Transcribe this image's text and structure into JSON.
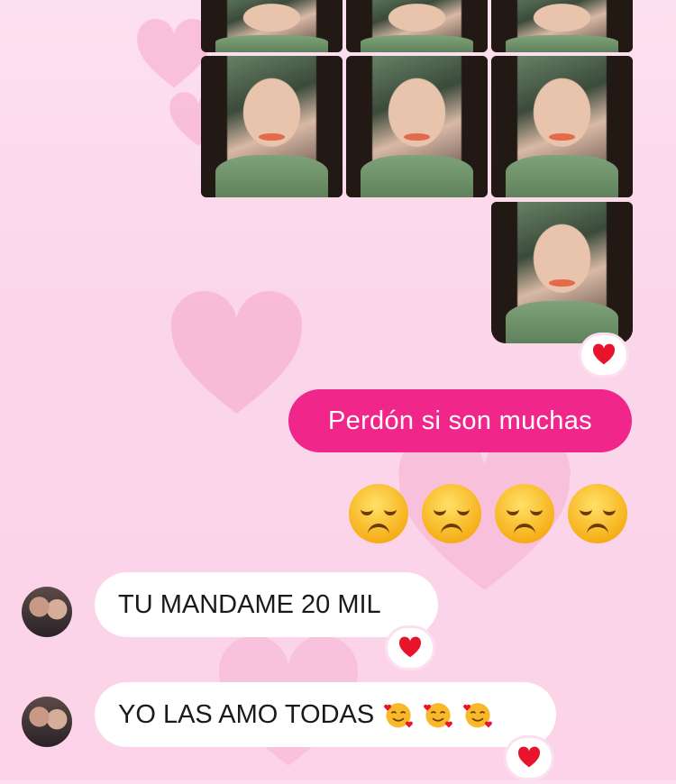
{
  "messages": [
    {
      "from": "me",
      "type": "text",
      "text": "Perdón si son muchas"
    },
    {
      "from": "me",
      "type": "emoji",
      "text": "😞😞😞😞"
    },
    {
      "from": "them",
      "type": "text",
      "text": "TU MANDAME 20 MIL"
    },
    {
      "from": "them",
      "type": "text",
      "text": "YO LAS AMO TODAS"
    }
  ],
  "icons": {
    "reaction": "red-heart-icon",
    "background": "heart-icon",
    "sad": "sad-face-emoji",
    "love": "smiling-face-with-hearts-emoji"
  },
  "colors": {
    "outgoing_bubble": "#f0268a",
    "incoming_bubble": "#ffffff",
    "background": "#fde0ef",
    "heart": "#e8142c"
  }
}
